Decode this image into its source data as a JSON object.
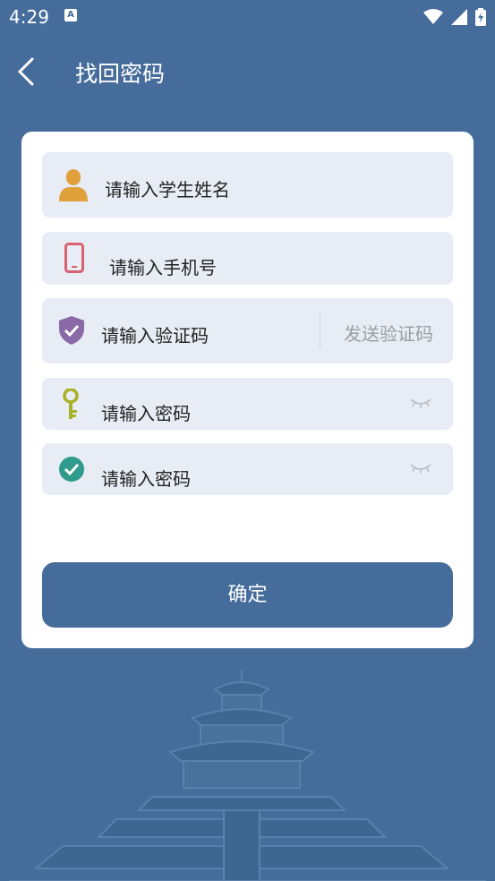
{
  "status_bar": {
    "time": "4:29",
    "notification_glyph": "A"
  },
  "app_bar": {
    "title": "找回密码",
    "back_icon": "chevron-left-icon"
  },
  "form": {
    "student_name": {
      "placeholder": "请输入学生姓名",
      "icon": "person-icon",
      "icon_color": "#e0a13b"
    },
    "phone": {
      "placeholder": "请输入手机号",
      "icon": "phone-icon",
      "icon_color": "#d9606e"
    },
    "code": {
      "placeholder": "请输入验证码",
      "icon": "shield-icon",
      "icon_color": "#8a6aa6",
      "send_label": "发送验证码"
    },
    "password": {
      "placeholder": "请输入密码",
      "icon": "key-icon",
      "icon_color": "#a8b226"
    },
    "confirm_password": {
      "placeholder": "请输入密码",
      "icon": "check-circle-icon",
      "icon_color": "#2e9b8c"
    },
    "confirm_button": "确定"
  },
  "colors": {
    "background": "#456c9b",
    "field_bg": "#e8ecf4",
    "button": "#456c9b"
  }
}
